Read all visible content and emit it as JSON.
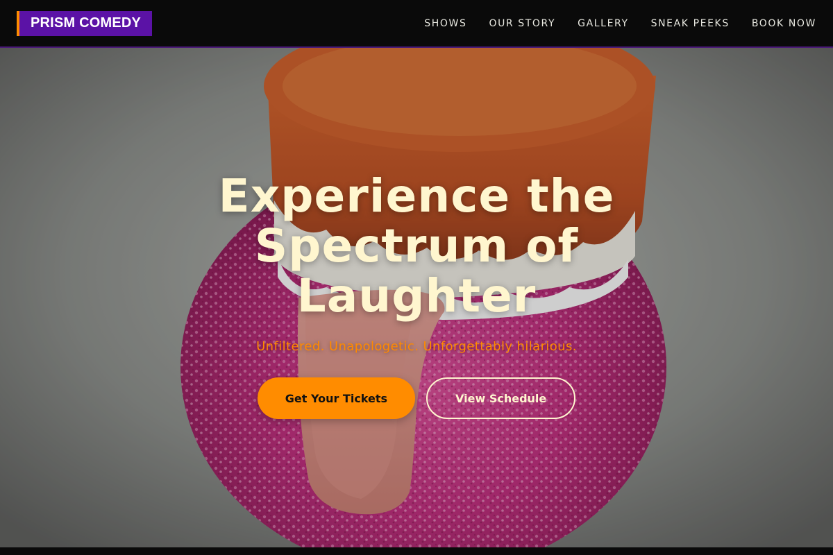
{
  "header": {
    "logo": "PRISM COMEDY",
    "nav": [
      {
        "label": "SHOWS"
      },
      {
        "label": "OUR STORY"
      },
      {
        "label": "GALLERY"
      },
      {
        "label": "SNEAK PEEKS"
      },
      {
        "label": "BOOK NOW"
      }
    ]
  },
  "hero": {
    "title": "Experience the Spectrum of Laughter",
    "subtitle": "Unfiltered. Unapologetic. Unforgettably hilarious.",
    "primary_button": "Get Your Tickets",
    "secondary_button": "View Schedule",
    "background_image": "wind-up chattering teeth toy with tongue on pink sponge"
  },
  "colors": {
    "accent": "#ff8c00",
    "brand": "#5b12a6",
    "title_text": "#fff6cf",
    "header_bg": "#0a0a0a"
  }
}
